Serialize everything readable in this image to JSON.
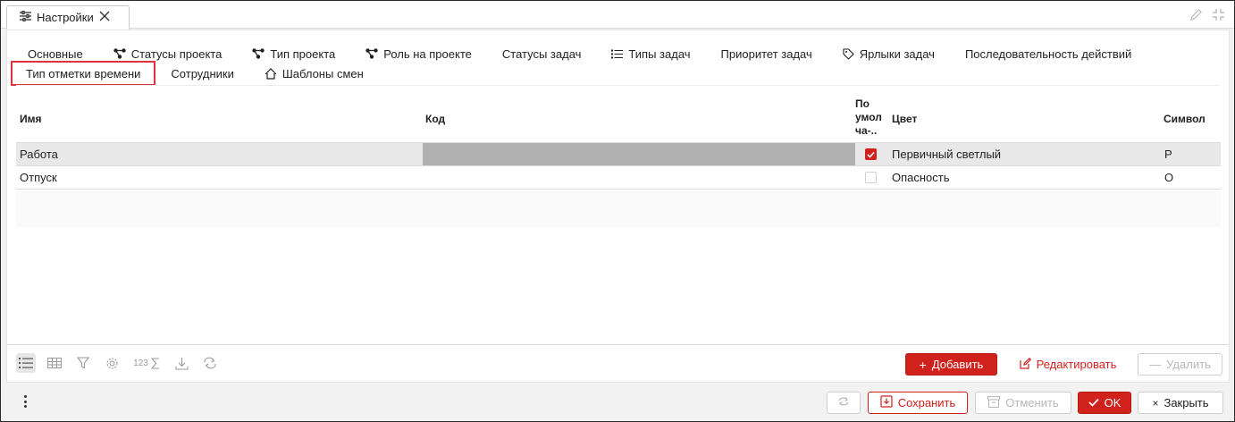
{
  "window": {
    "tab_title": "Настройки"
  },
  "tabs_row1": [
    {
      "label": "Основные",
      "icon": ""
    },
    {
      "label": "Статусы проекта",
      "icon": "tree-icon"
    },
    {
      "label": "Тип проекта",
      "icon": "tree-icon"
    },
    {
      "label": "Роль на проекте",
      "icon": "tree-icon"
    },
    {
      "label": "Статусы задач",
      "icon": ""
    },
    {
      "label": "Типы задач",
      "icon": "list-icon"
    },
    {
      "label": "Приоритет задач",
      "icon": ""
    },
    {
      "label": "Ярлыки задач",
      "icon": "tag-icon"
    },
    {
      "label": "Последовательность действий",
      "icon": ""
    }
  ],
  "tabs_row2": [
    {
      "label": "Тип отметки времени",
      "icon": "",
      "active": true
    },
    {
      "label": "Сотрудники",
      "icon": ""
    },
    {
      "label": "Шаблоны смен",
      "icon": "house-icon"
    }
  ],
  "grid": {
    "columns": {
      "name": "Имя",
      "code": "Код",
      "default_1": "По",
      "default_2": "умол",
      "default_3": "ча-..",
      "color": "Цвет",
      "symbol": "Символ"
    },
    "rows": [
      {
        "name": "Работа",
        "code": "",
        "default": true,
        "color": "Первичный светлый",
        "symbol": "Р",
        "selected": true
      },
      {
        "name": "Отпуск",
        "code": "",
        "default": false,
        "color": "Опасность",
        "symbol": "О",
        "selected": false
      }
    ]
  },
  "toolbar": {
    "sum_label": "123"
  },
  "actions": {
    "add": "Добавить",
    "edit": "Редактировать",
    "delete": "Удалить"
  },
  "footer": {
    "save": "Сохранить",
    "cancel": "Отменить",
    "ok": "OK",
    "close": "Закрыть"
  },
  "colors": {
    "accent": "#d0211c",
    "selected_row": "#e8e8e8",
    "code_cell": "#b0b0b0"
  }
}
